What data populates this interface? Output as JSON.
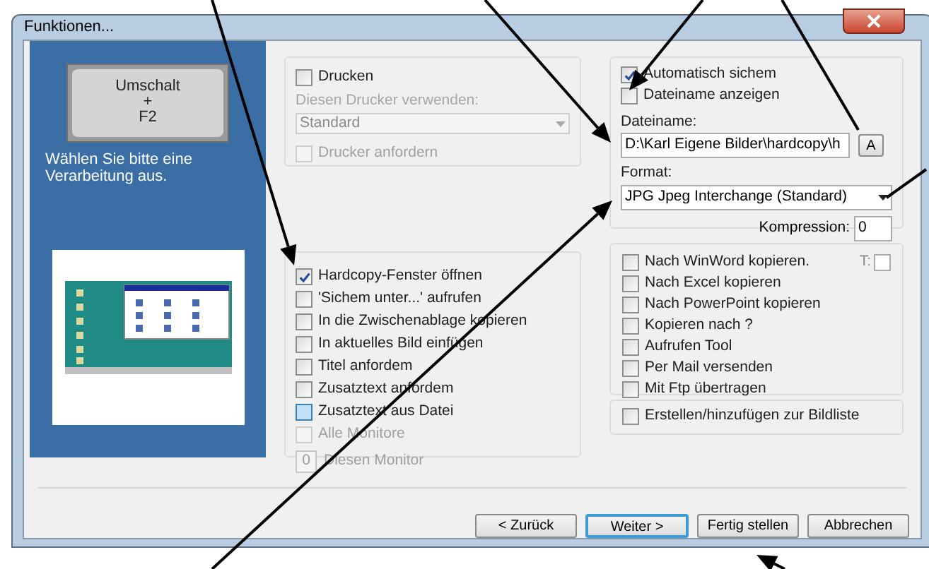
{
  "window": {
    "title": "Funktionen..."
  },
  "sidebar": {
    "key_lines": [
      "Umschalt",
      "+",
      "F2"
    ],
    "instruction": "Wählen Sie bitte eine Verarbeitung aus."
  },
  "print_group": {
    "print": {
      "label": "Drucken",
      "checked": false,
      "disabled": false
    },
    "printer_label": "Diesen Drucker verwenden:",
    "printer_select": {
      "value": "Standard",
      "disabled": true
    },
    "request_printer": {
      "label": "Drucker anfordern",
      "checked": false,
      "disabled": true
    }
  },
  "actions": [
    {
      "kind": "checkbox",
      "label": "Hardcopy-Fenster öffnen",
      "checked": true,
      "disabled": false
    },
    {
      "kind": "checkbox",
      "label": "'Sichem unter...' aufrufen",
      "checked": false,
      "disabled": false
    },
    {
      "kind": "checkbox",
      "label": "In die Zwischenablage kopieren",
      "checked": false,
      "disabled": false
    },
    {
      "kind": "checkbox",
      "label": "In aktuelles Bild einfügen",
      "checked": false,
      "disabled": false
    },
    {
      "kind": "checkbox",
      "label": "Titel anfordem",
      "checked": false,
      "disabled": false
    },
    {
      "kind": "checkbox",
      "label": "Zusatztext anfordem",
      "checked": false,
      "disabled": false
    },
    {
      "kind": "checkbox",
      "label": "Zusatztext aus Datei",
      "checked": false,
      "disabled": false,
      "hovered": true
    },
    {
      "kind": "checkbox",
      "label": "Alle Monitore",
      "checked": false,
      "disabled": true
    },
    {
      "kind": "number",
      "value": "0",
      "label": "Diesen Monitor",
      "disabled": true
    }
  ],
  "save_group": {
    "auto_save": {
      "label": "Automatisch sichem",
      "checked": true
    },
    "show_filename": {
      "label": "Dateiname anzeigen",
      "checked": false
    },
    "filename_label": "Dateiname:",
    "filename": "D:\\Karl Eigene Bilder\\hardcopy\\h",
    "browse_button": "A",
    "format_label": "Format:",
    "format": "JPG  Jpeg Interchange (Standard)",
    "compression_label": "Kompression:",
    "compression": "0"
  },
  "export": [
    {
      "label": "Nach WinWord kopieren.",
      "checked": false,
      "suffix_label": "T:"
    },
    {
      "label": "Nach Excel kopieren",
      "checked": false
    },
    {
      "label": "Nach PowerPoint kopieren",
      "checked": false
    },
    {
      "label": "Kopieren nach ?",
      "checked": false
    },
    {
      "label": "Aufrufen Tool",
      "checked": false
    },
    {
      "label": "Per Mail versenden",
      "checked": false
    },
    {
      "label": "Mit Ftp übertragen",
      "checked": false
    }
  ],
  "picture_list": {
    "label": "Erstellen/hinzufügen zur Bildliste",
    "checked": false
  },
  "buttons": [
    {
      "label": "< Zurück",
      "default": false
    },
    {
      "label": "Weiter >",
      "default": true
    },
    {
      "label": "Fertig stellen",
      "default": false
    },
    {
      "label": "Abbrechen",
      "default": false
    }
  ]
}
